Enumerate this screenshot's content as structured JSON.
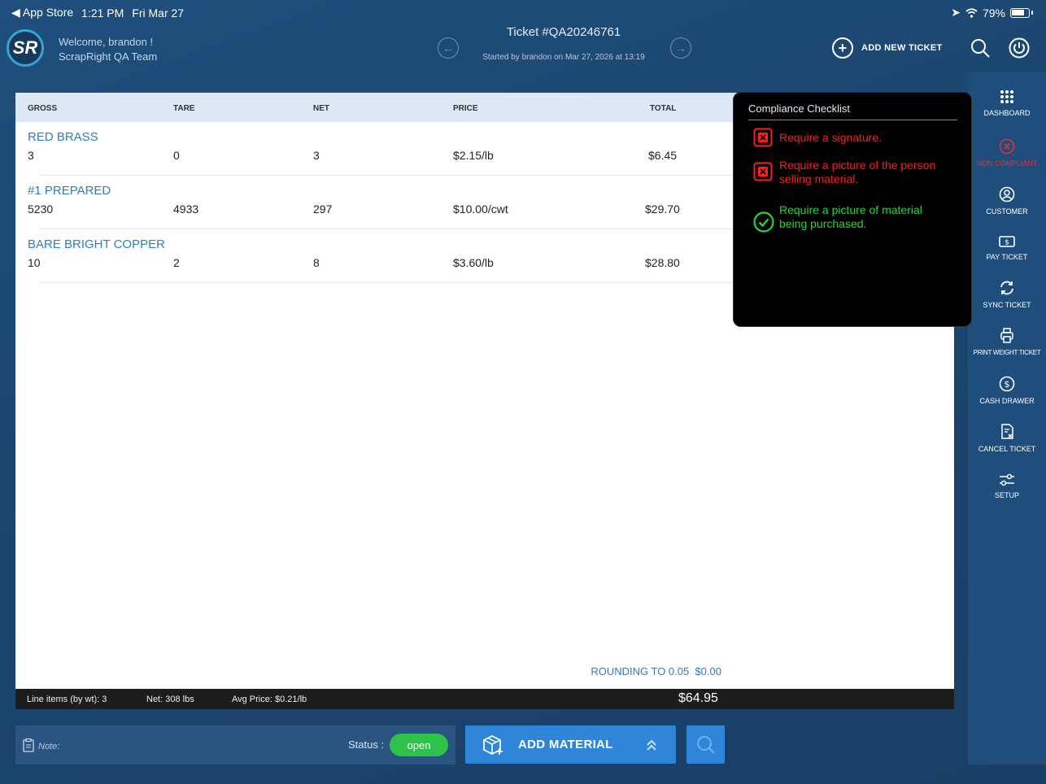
{
  "status_bar": {
    "back_app": "App Store",
    "time": "1:21 PM",
    "date": "Fri Mar 27",
    "battery": "79%"
  },
  "header": {
    "welcome_line1": "Welcome, brandon !",
    "welcome_line2": "ScrapRight QA Team",
    "ticket_title": "Ticket #QA20246761",
    "ticket_sub": "Started by brandon  on Mar 27, 2026 at 13:19",
    "add_ticket_label": "ADD NEW TICKET"
  },
  "table": {
    "columns": [
      "GROSS",
      "TARE",
      "NET",
      "PRICE",
      "TOTAL"
    ],
    "rows": [
      {
        "name": "RED BRASS",
        "gross": "3",
        "tare": "0",
        "net": "3",
        "price": "$2.15/lb",
        "total": "$6.45"
      },
      {
        "name": "#1 PREPARED",
        "gross": "5230",
        "tare": "4933",
        "net": "297",
        "price": "$10.00/cwt",
        "total": "$29.70"
      },
      {
        "name": "BARE BRIGHT COPPER",
        "gross": "10",
        "tare": "2",
        "net": "8",
        "price": "$3.60/lb",
        "total": "$28.80"
      }
    ],
    "rounding_label": "ROUNDING TO 0.05",
    "rounding_value": "$0.00"
  },
  "footer": {
    "line_items": "Line items (by wt): 3",
    "net": "Net: 308 lbs",
    "avg_price": "Avg Price: $0.21/lb",
    "total": "$64.95"
  },
  "bottom": {
    "note_label": "Note:",
    "status_label": "Status :",
    "status_value": "open",
    "add_material_label": "ADD MATERIAL"
  },
  "sidebar": {
    "items": [
      {
        "label": "DASHBOARD",
        "icon": "grid-icon"
      },
      {
        "label": "NON COMPLIANT",
        "icon": "x-circle-icon"
      },
      {
        "label": "CUSTOMER",
        "icon": "user-circle-icon"
      },
      {
        "label": "PAY TICKET",
        "icon": "cash-icon"
      },
      {
        "label": "SYNC TICKET",
        "icon": "sync-icon"
      },
      {
        "label": "PRINT WEIGHT TICKET",
        "icon": "printer-icon"
      },
      {
        "label": "CASH DRAWER",
        "icon": "dollar-circle-icon"
      },
      {
        "label": "CANCEL TICKET",
        "icon": "cancel-doc-icon"
      },
      {
        "label": "SETUP",
        "icon": "sliders-icon"
      }
    ]
  },
  "compliance": {
    "title": "Compliance Checklist",
    "items": [
      {
        "text": "Require a signature.",
        "status": "fail"
      },
      {
        "text": "Require a picture of the person selling material.",
        "status": "fail"
      },
      {
        "text": "Require a picture of material being purchased.",
        "status": "pass"
      }
    ]
  },
  "colors": {
    "accent": "#2f86d8",
    "link": "#2f7cc0",
    "fail": "#ff1d1d",
    "pass": "#22d63c",
    "open_status": "#2ec24a"
  }
}
